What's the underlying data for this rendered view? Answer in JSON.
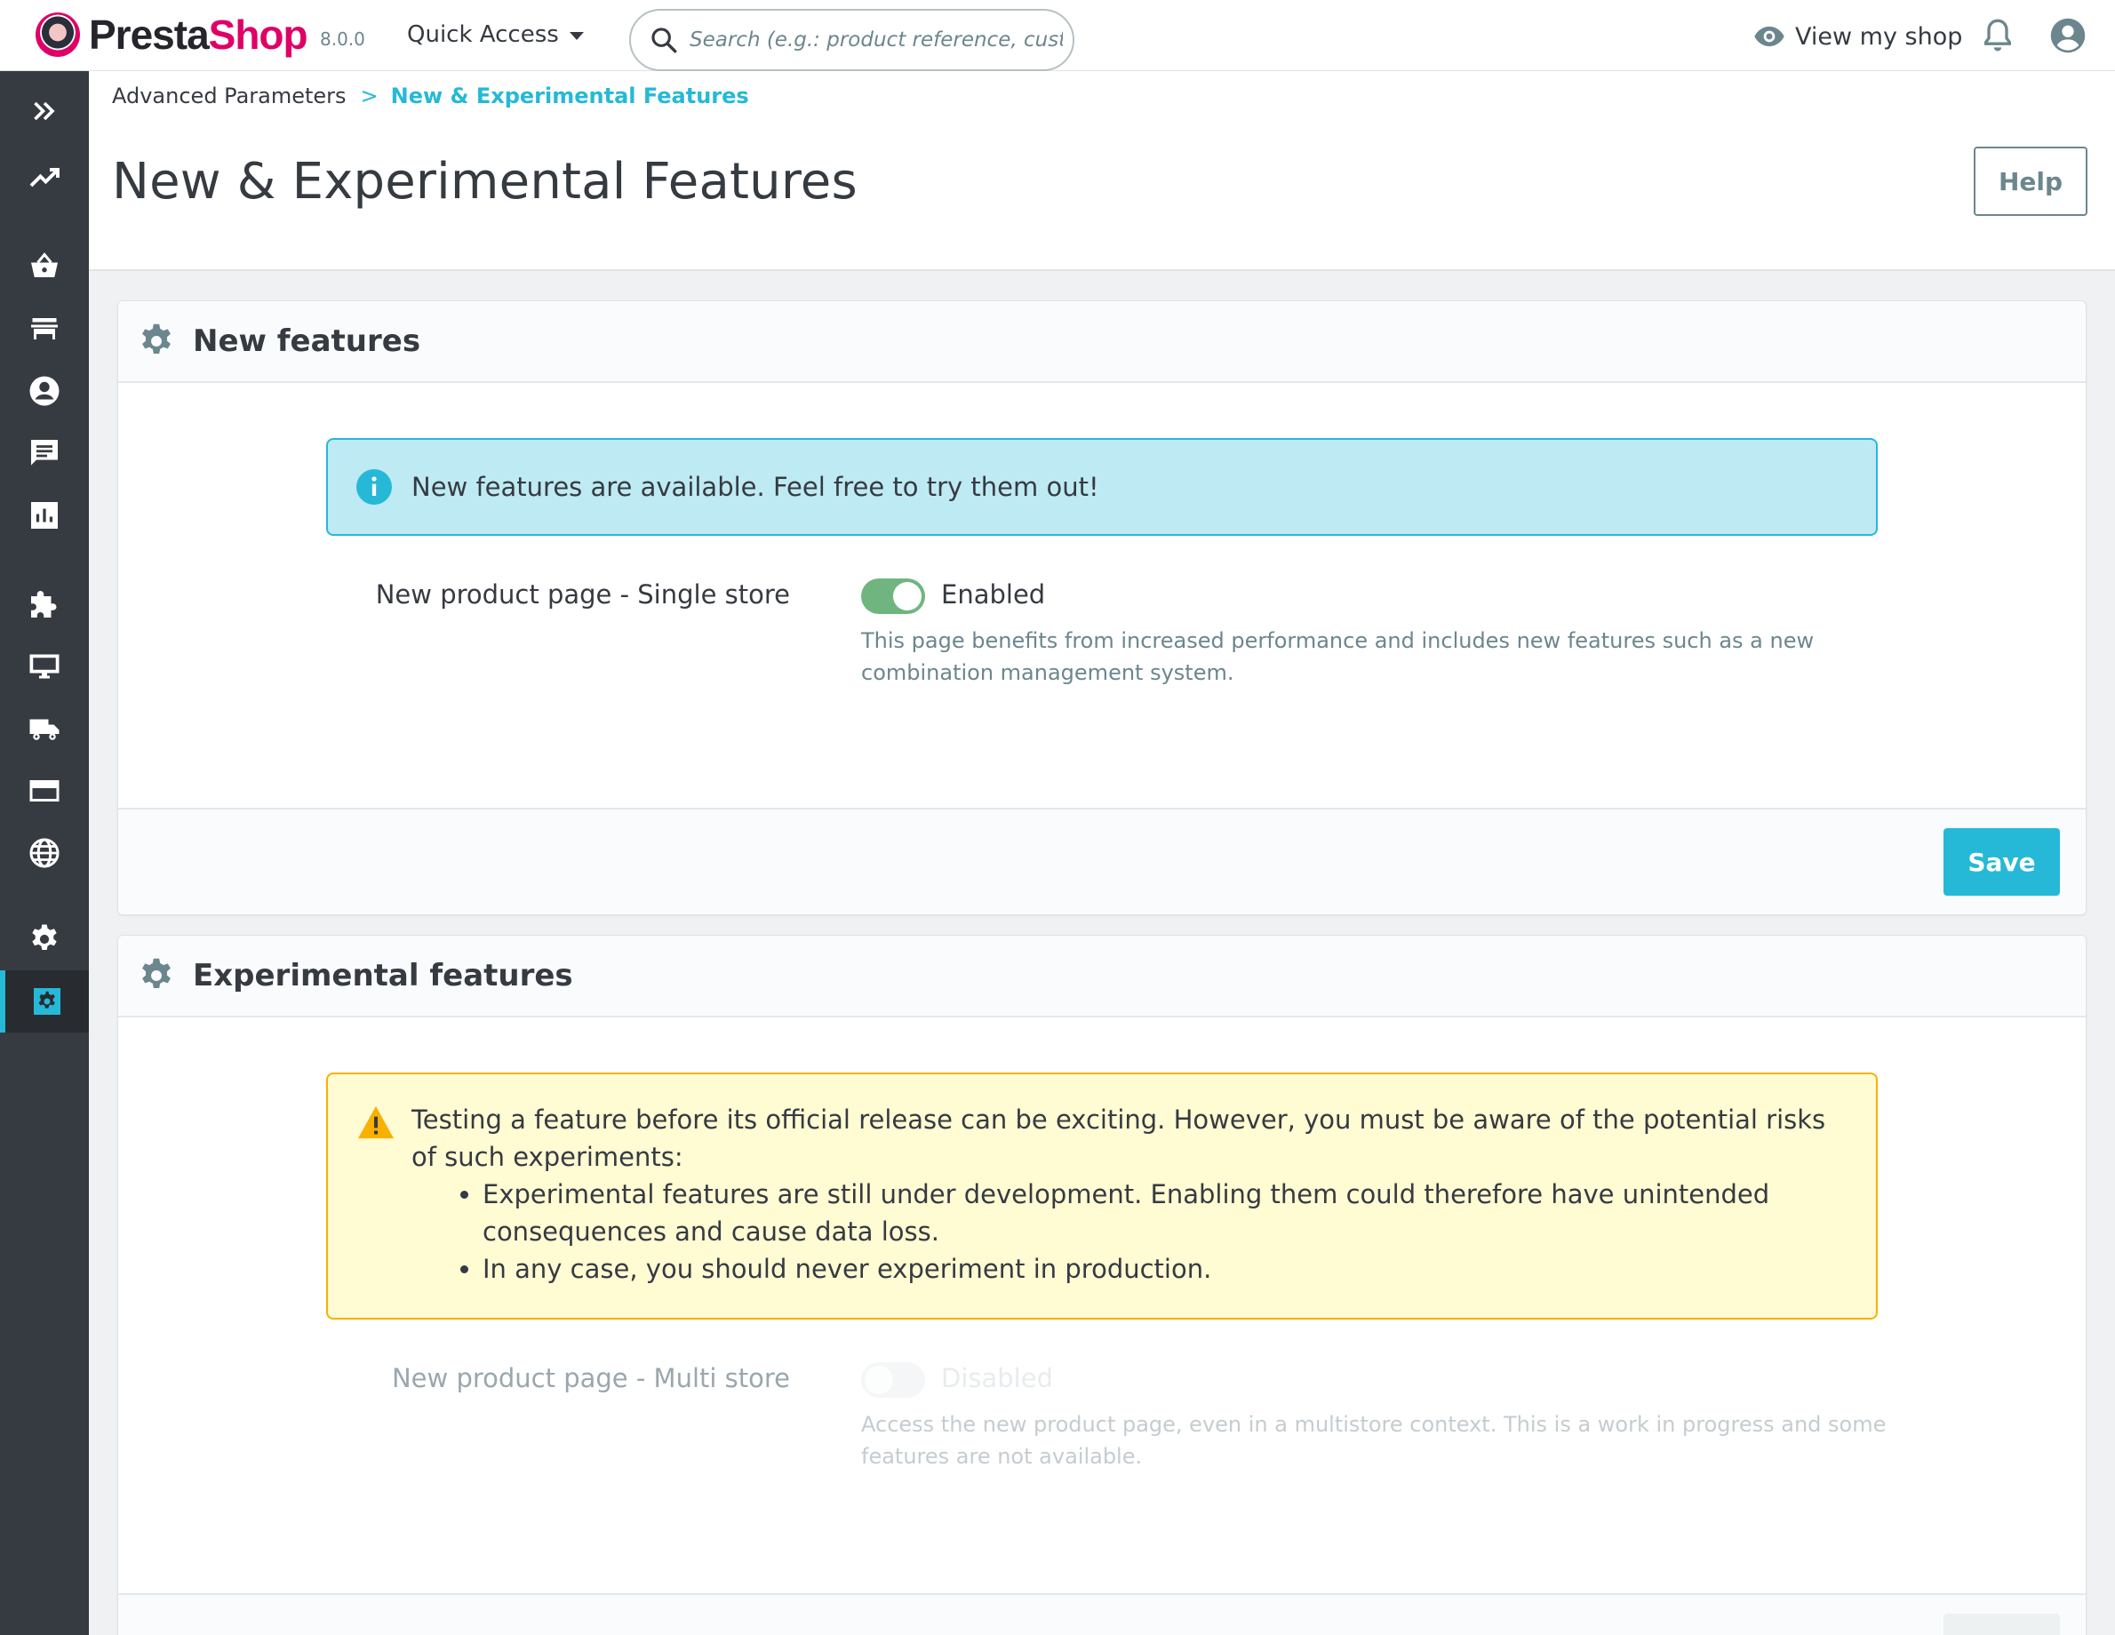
{
  "header": {
    "logo_part1": "Presta",
    "logo_part2": "Shop",
    "version": "8.0.0",
    "quick_access": "Quick Access",
    "search_placeholder": "Search (e.g.: product reference, custon",
    "view_shop": "View my shop"
  },
  "sidebar": {
    "items": [
      {
        "icon": "expand-icon"
      },
      {
        "icon": "dashboard-trend-icon"
      },
      {
        "icon": "orders-basket-icon"
      },
      {
        "icon": "catalog-store-icon"
      },
      {
        "icon": "customers-icon"
      },
      {
        "icon": "messages-icon"
      },
      {
        "icon": "stats-icon"
      },
      {
        "icon": "modules-puzzle-icon"
      },
      {
        "icon": "design-monitor-icon"
      },
      {
        "icon": "shipping-truck-icon"
      },
      {
        "icon": "payment-card-icon"
      },
      {
        "icon": "international-globe-icon"
      },
      {
        "icon": "configure-gear-icon"
      },
      {
        "icon": "advanced-parameters-icon",
        "active": true
      }
    ],
    "active_color": "#25b9d7"
  },
  "breadcrumb": {
    "parent": "Advanced Parameters",
    "separator": ">",
    "current": "New & Experimental Features"
  },
  "page": {
    "title": "New & Experimental Features",
    "help_button": "Help"
  },
  "new_features": {
    "title": "New features",
    "alert": "New features are available. Feel free to try them out!",
    "feature_label": "New product page - Single store",
    "toggle_state": "Enabled",
    "toggle_on": true,
    "help": "This page benefits from increased performance and includes new features such as a new combination management system.",
    "save_button": "Save"
  },
  "experimental_features": {
    "title": "Experimental features",
    "warning_intro": "Testing a feature before its official release can be exciting. However, you must be aware of the potential risks of such experiments:",
    "warning_items": [
      "Experimental features are still under development. Enabling them could therefore have unintended consequences and cause data loss.",
      "In any case, you should never experiment in production."
    ],
    "feature_label": "New product page - Multi store",
    "toggle_state": "Disabled",
    "toggle_on": false,
    "help": "Access the new product page, even in a multistore context. This is a work in progress and some features are not available."
  },
  "colors": {
    "accent": "#25b9d7",
    "toggle_on": "#70b580",
    "warning_border": "#fab000",
    "sidebar_bg": "#363a41"
  }
}
